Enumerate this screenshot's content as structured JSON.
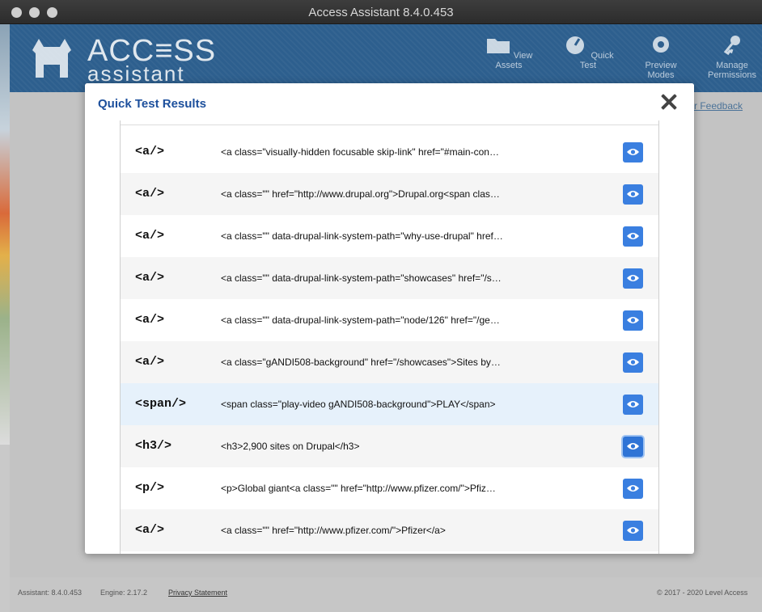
{
  "window": {
    "title": "Access Assistant 8.4.0.453"
  },
  "app": {
    "logo_line1": "ACC≡SS",
    "logo_line2": "assistant",
    "nav": [
      {
        "label": "View Assets",
        "icon": "folder-icon"
      },
      {
        "label": "Quick Test",
        "icon": "speedometer-icon"
      },
      {
        "label": "Preview Modes",
        "icon": "gear-icon"
      },
      {
        "label": "Manage Permissions",
        "icon": "key-icon"
      }
    ],
    "feedback_link": "r Feedback"
  },
  "modal": {
    "title": "Quick Test Results",
    "rows": [
      {
        "tag": "<a/>",
        "code": "<a class=\"visually-hidden focusable skip-link\" href=\"#main-con…"
      },
      {
        "tag": "<a/>",
        "code": "<a class=\"\" href=\"http://www.drupal.org\">Drupal.org<span clas…"
      },
      {
        "tag": "<a/>",
        "code": "<a class=\"\" data-drupal-link-system-path=\"why-use-drupal\" href…"
      },
      {
        "tag": "<a/>",
        "code": "<a class=\"\" data-drupal-link-system-path=\"showcases\" href=\"/s…"
      },
      {
        "tag": "<a/>",
        "code": "<a class=\"\" data-drupal-link-system-path=\"node/126\" href=\"/ge…"
      },
      {
        "tag": "<a/>",
        "code": "<a class=\"gANDI508-background\" href=\"/showcases\">Sites by…"
      },
      {
        "tag": "<span/>",
        "code": "<span class=\"play-video gANDI508-background\">PLAY</span>"
      },
      {
        "tag": "<h3/>",
        "code": "<h3>2,900 sites on Drupal</h3>"
      },
      {
        "tag": "<p/>",
        "code": "<p>Global giant<a class=\"\" href=\"http://www.pfizer.com/\">Pfiz…"
      },
      {
        "tag": "<a/>",
        "code": "<a class=\"\" href=\"http://www.pfizer.com/\">Pfizer</a>"
      }
    ]
  },
  "footer": {
    "assistant_version": "Assistant: 8.4.0.453",
    "engine_version": "Engine: 2.17.2",
    "privacy": "Privacy Statement",
    "copyright": "© 2017 - 2020 Level Access"
  },
  "colors": {
    "accent": "#3a7fe0",
    "title": "#1c4f9c",
    "header_bg": "#2d5f8e"
  }
}
